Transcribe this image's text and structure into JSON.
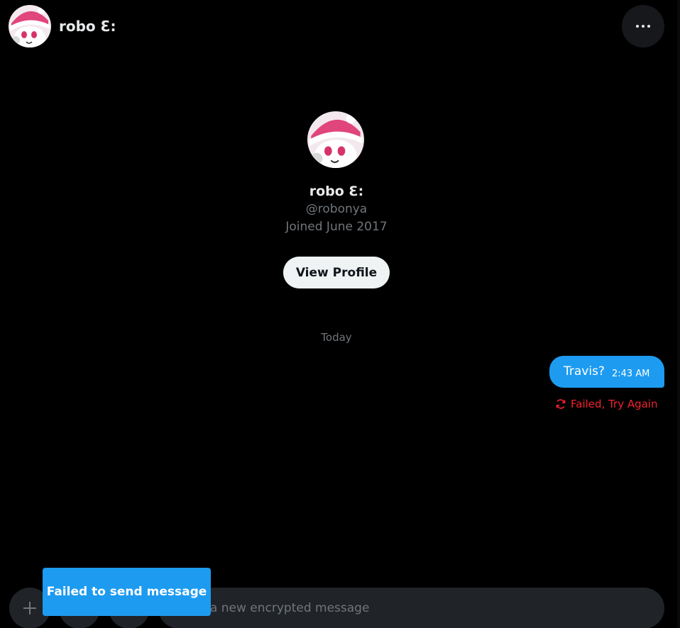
{
  "header": {
    "name": "robo Ɛ:",
    "more_icon": "more-horizontal-icon"
  },
  "profile": {
    "name": "robo Ɛ:",
    "handle": "@robonya",
    "joined": "Joined June 2017",
    "view_profile_label": "View Profile"
  },
  "conversation": {
    "day_label": "Today",
    "messages": [
      {
        "text": "Travis?",
        "time": "2:43 AM",
        "status": "Failed, Try Again",
        "status_icon": "retry-icon"
      }
    ]
  },
  "composer": {
    "placeholder": "Start a new encrypted message",
    "add_icon": "plus-icon"
  },
  "toast": {
    "text": "Failed to send message"
  },
  "colors": {
    "background": "#000000",
    "accent": "#1d9bf0",
    "error": "#f4212e",
    "muted": "#71767b",
    "surface": "#202327"
  }
}
